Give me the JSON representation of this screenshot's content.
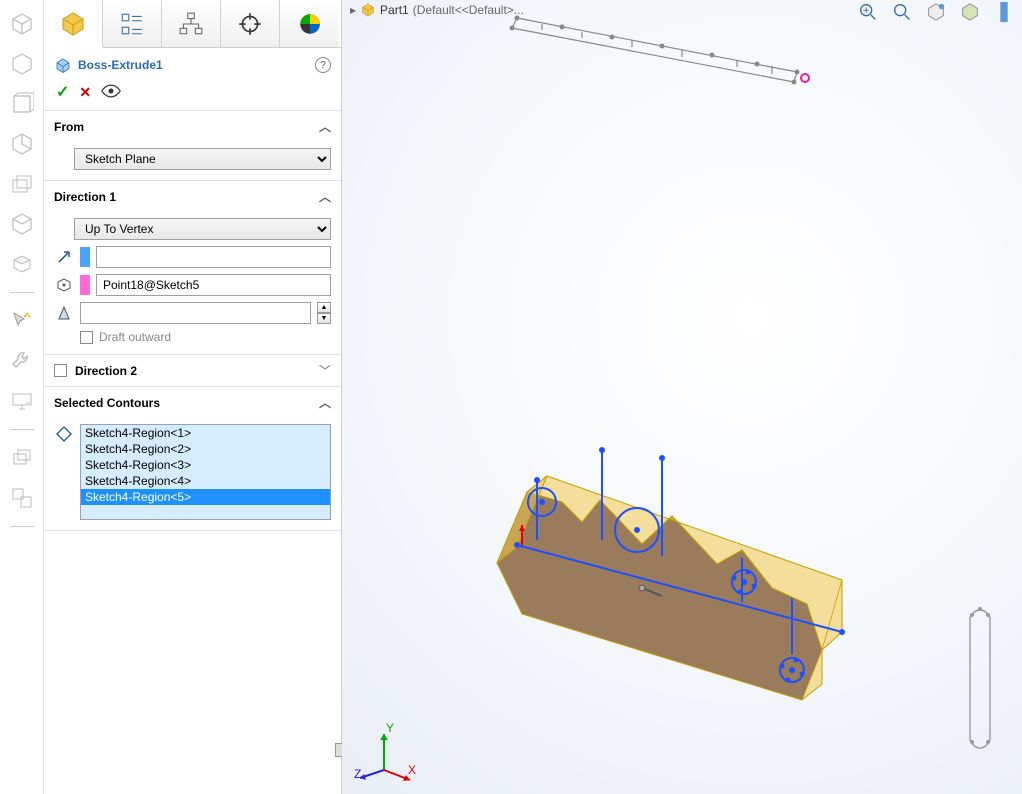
{
  "breadcrumb": {
    "part": "Part1",
    "display": "(Default<<Default>..."
  },
  "feature": {
    "name": "Boss-Extrude1"
  },
  "from": {
    "label": "From",
    "plane": "Sketch Plane"
  },
  "direction1": {
    "label": "Direction 1",
    "end_condition": "Up To Vertex",
    "direction_field": "",
    "vertex_field": "Point18@Sketch5",
    "draft_outward_label": "Draft outward"
  },
  "direction2": {
    "label": "Direction 2"
  },
  "selected_contours": {
    "label": "Selected Contours",
    "items": [
      "Sketch4-Region<1>",
      "Sketch4-Region<2>",
      "Sketch4-Region<3>",
      "Sketch4-Region<4>",
      "Sketch4-Region<5>"
    ],
    "selected_index": 4
  },
  "triad": {
    "x": "X",
    "y": "Y",
    "z": "Z"
  },
  "colors": {
    "accent_yellow": "#f2c94c",
    "sketch_blue": "#1e50ff",
    "sel_pink": "#e91e9e"
  }
}
